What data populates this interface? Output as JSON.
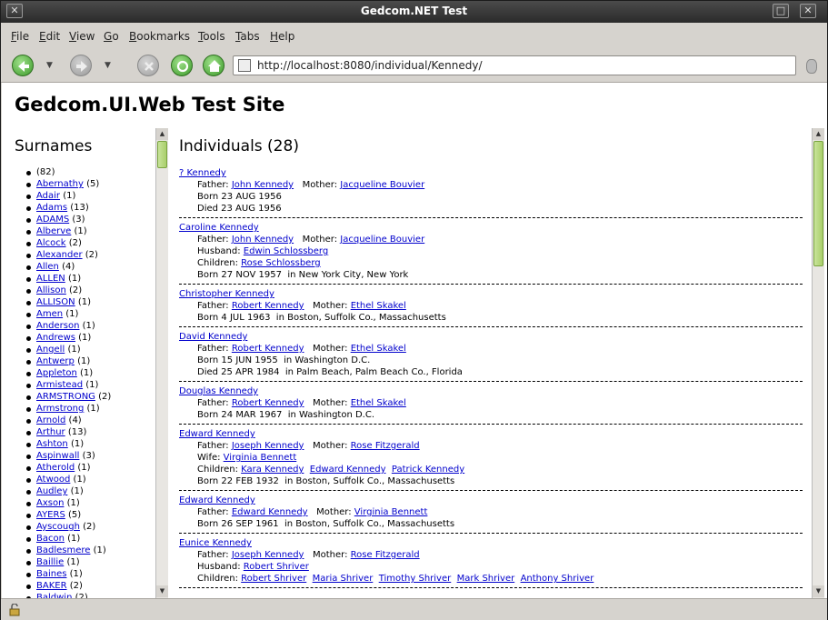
{
  "window": {
    "title": "Gedcom.NET Test"
  },
  "menu": [
    "File",
    "Edit",
    "View",
    "Go",
    "Bookmarks",
    "Tools",
    "Tabs",
    "Help"
  ],
  "address": {
    "url": "http://localhost:8080/individual/Kennedy/"
  },
  "page": {
    "heading": "Gedcom.UI.Web Test Site"
  },
  "surnames": {
    "heading": "Surnames",
    "items": [
      {
        "name": "",
        "count": "(82)"
      },
      {
        "name": "Abernathy",
        "count": "(5)"
      },
      {
        "name": "Adair",
        "count": "(1)"
      },
      {
        "name": "Adams",
        "count": "(13)"
      },
      {
        "name": "ADAMS",
        "count": "(3)"
      },
      {
        "name": "Alberve",
        "count": "(1)"
      },
      {
        "name": "Alcock",
        "count": "(2)"
      },
      {
        "name": "Alexander",
        "count": "(2)"
      },
      {
        "name": "Allen",
        "count": "(4)"
      },
      {
        "name": "ALLEN",
        "count": "(1)"
      },
      {
        "name": "Allison",
        "count": "(2)"
      },
      {
        "name": "ALLISON",
        "count": "(1)"
      },
      {
        "name": "Amen",
        "count": "(1)"
      },
      {
        "name": "Anderson",
        "count": "(1)"
      },
      {
        "name": "Andrews",
        "count": "(1)"
      },
      {
        "name": "Angell",
        "count": "(1)"
      },
      {
        "name": "Antwerp",
        "count": "(1)"
      },
      {
        "name": "Appleton",
        "count": "(1)"
      },
      {
        "name": "Armistead",
        "count": "(1)"
      },
      {
        "name": "ARMSTRONG",
        "count": "(2)"
      },
      {
        "name": "Armstrong",
        "count": "(1)"
      },
      {
        "name": "Arnold",
        "count": "(4)"
      },
      {
        "name": "Arthur",
        "count": "(13)"
      },
      {
        "name": "Ashton",
        "count": "(1)"
      },
      {
        "name": "Aspinwall",
        "count": "(3)"
      },
      {
        "name": "Atherold",
        "count": "(1)"
      },
      {
        "name": "Atwood",
        "count": "(1)"
      },
      {
        "name": "Audley",
        "count": "(1)"
      },
      {
        "name": "Axson",
        "count": "(1)"
      },
      {
        "name": "AYERS",
        "count": "(5)"
      },
      {
        "name": "Ayscough",
        "count": "(2)"
      },
      {
        "name": "Bacon",
        "count": "(1)"
      },
      {
        "name": "Badlesmere",
        "count": "(1)"
      },
      {
        "name": "Baillie",
        "count": "(1)"
      },
      {
        "name": "Baines",
        "count": "(1)"
      },
      {
        "name": "BAKER",
        "count": "(2)"
      },
      {
        "name": "Baldwin",
        "count": "(2)"
      }
    ]
  },
  "individuals": {
    "heading": "Individuals (28)",
    "people": [
      {
        "name": "? Kennedy",
        "lines": [
          [
            {
              "t": "Father: "
            },
            {
              "l": "John Kennedy"
            },
            {
              "t": "   Mother: "
            },
            {
              "l": "Jacqueline Bouvier"
            }
          ],
          [
            {
              "t": "Born 23 AUG 1956"
            }
          ],
          [
            {
              "t": "Died 23 AUG 1956"
            }
          ]
        ]
      },
      {
        "name": "Caroline Kennedy",
        "lines": [
          [
            {
              "t": "Father: "
            },
            {
              "l": "John Kennedy"
            },
            {
              "t": "   Mother: "
            },
            {
              "l": "Jacqueline Bouvier"
            }
          ],
          [
            {
              "t": "Husband: "
            },
            {
              "l": "Edwin Schlossberg"
            }
          ],
          [
            {
              "t": "Children: "
            },
            {
              "l": "Rose Schlossberg"
            }
          ],
          [
            {
              "t": "Born 27 NOV 1957  in New York City, New York"
            }
          ]
        ]
      },
      {
        "name": "Christopher Kennedy",
        "lines": [
          [
            {
              "t": "Father: "
            },
            {
              "l": "Robert Kennedy"
            },
            {
              "t": "   Mother: "
            },
            {
              "l": "Ethel Skakel"
            }
          ],
          [
            {
              "t": "Born 4 JUL 1963  in Boston, Suffolk Co., Massachusetts"
            }
          ]
        ]
      },
      {
        "name": "David Kennedy",
        "lines": [
          [
            {
              "t": "Father: "
            },
            {
              "l": "Robert Kennedy"
            },
            {
              "t": "   Mother: "
            },
            {
              "l": "Ethel Skakel"
            }
          ],
          [
            {
              "t": "Born 15 JUN 1955  in Washington D.C."
            }
          ],
          [
            {
              "t": "Died 25 APR 1984  in Palm Beach, Palm Beach Co., Florida"
            }
          ]
        ]
      },
      {
        "name": "Douglas Kennedy",
        "lines": [
          [
            {
              "t": "Father: "
            },
            {
              "l": "Robert Kennedy"
            },
            {
              "t": "   Mother: "
            },
            {
              "l": "Ethel Skakel"
            }
          ],
          [
            {
              "t": "Born 24 MAR 1967  in Washington D.C."
            }
          ]
        ]
      },
      {
        "name": "Edward Kennedy",
        "lines": [
          [
            {
              "t": "Father: "
            },
            {
              "l": "Joseph Kennedy"
            },
            {
              "t": "   Mother: "
            },
            {
              "l": "Rose Fitzgerald"
            }
          ],
          [
            {
              "t": "Wife: "
            },
            {
              "l": "Virginia Bennett"
            }
          ],
          [
            {
              "t": "Children: "
            },
            {
              "l": "Kara Kennedy"
            },
            {
              "t": "  "
            },
            {
              "l": "Edward Kennedy"
            },
            {
              "t": "  "
            },
            {
              "l": "Patrick Kennedy"
            }
          ],
          [
            {
              "t": "Born 22 FEB 1932  in Boston, Suffolk Co., Massachusetts"
            }
          ]
        ]
      },
      {
        "name": "Edward Kennedy",
        "lines": [
          [
            {
              "t": "Father: "
            },
            {
              "l": "Edward Kennedy"
            },
            {
              "t": "   Mother: "
            },
            {
              "l": "Virginia Bennett"
            }
          ],
          [
            {
              "t": "Born 26 SEP 1961  in Boston, Suffolk Co., Massachusetts"
            }
          ]
        ]
      },
      {
        "name": "Eunice Kennedy",
        "lines": [
          [
            {
              "t": "Father: "
            },
            {
              "l": "Joseph Kennedy"
            },
            {
              "t": "   Mother: "
            },
            {
              "l": "Rose Fitzgerald"
            }
          ],
          [
            {
              "t": "Husband: "
            },
            {
              "l": "Robert Shriver"
            }
          ],
          [
            {
              "t": "Children: "
            },
            {
              "l": "Robert Shriver"
            },
            {
              "t": "  "
            },
            {
              "l": "Maria Shriver"
            },
            {
              "t": "  "
            },
            {
              "l": "Timothy Shriver"
            },
            {
              "t": "  "
            },
            {
              "l": "Mark Shriver"
            },
            {
              "t": "  "
            },
            {
              "l": "Anthony Shriver"
            }
          ]
        ]
      }
    ]
  }
}
